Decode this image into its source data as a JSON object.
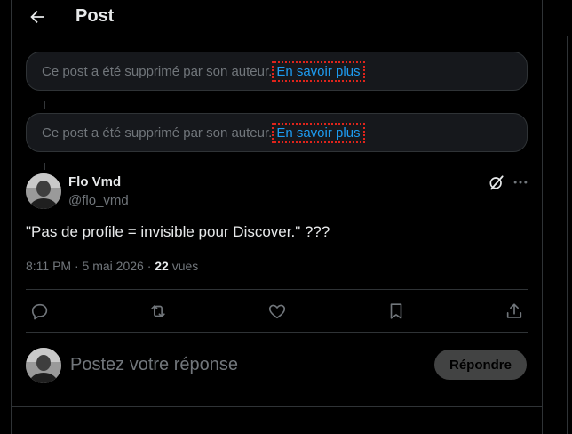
{
  "header": {
    "title": "Post"
  },
  "deleted_notice": {
    "text": "Ce post a été supprimé par son auteur.",
    "link": "En savoir plus"
  },
  "post": {
    "author_name": "Flo Vmd",
    "author_handle": "@flo_vmd",
    "text": "\"Pas de profile = invisible pour Discover.\" ???",
    "time": "8:11 PM · 5 mai 2026 · ",
    "views_count": "22",
    "views_label": " vues"
  },
  "actions": [
    "reply-icon",
    "repost-icon",
    "like-icon",
    "bookmark-icon",
    "share-icon"
  ],
  "composer": {
    "placeholder": "Postez votre réponse",
    "button": "Répondre"
  },
  "colors": {
    "accent": "#1d9bf0",
    "background": "#000000",
    "muted": "#71767b",
    "focus_outline": "#e0241b"
  }
}
